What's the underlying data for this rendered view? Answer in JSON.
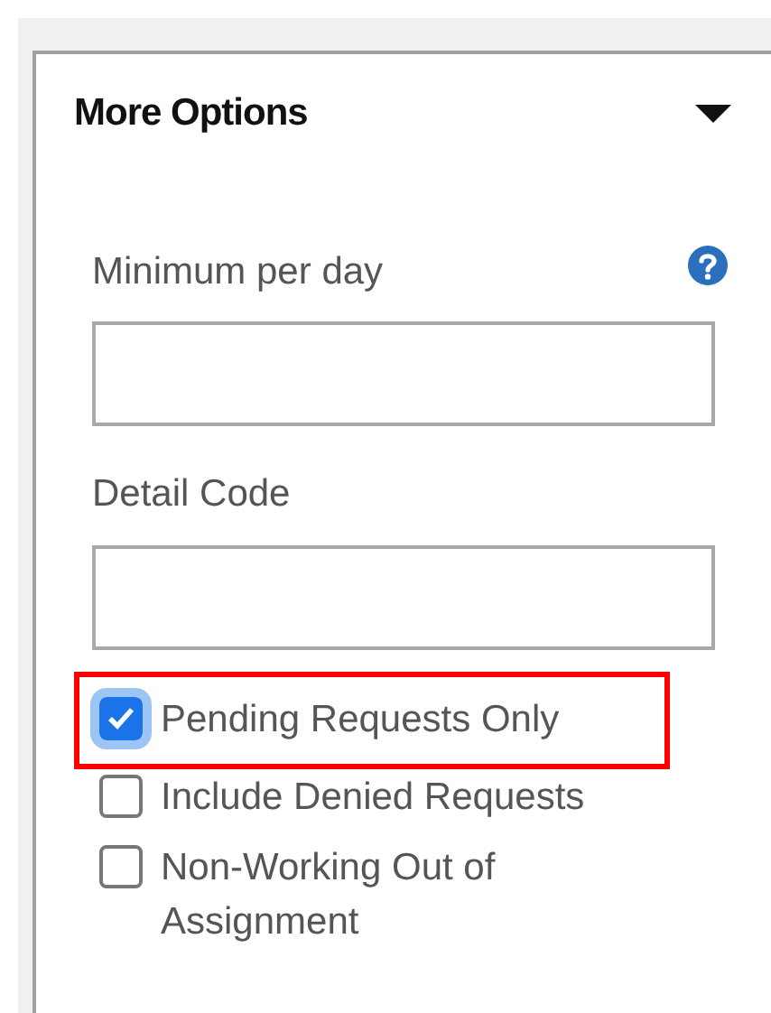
{
  "panel": {
    "title": "More Options",
    "expanded": true
  },
  "fields": [
    {
      "label": "Minimum per day",
      "help": true
    },
    {
      "label": "Detail Code",
      "help": false
    }
  ],
  "options": [
    {
      "label": "Pending Requests Only",
      "checked": true,
      "highlighted": true
    },
    {
      "label": "Include Denied Requests",
      "checked": false,
      "highlighted": false
    },
    {
      "label": "Non-Working Out of Assignment",
      "checked": false,
      "highlighted": false
    }
  ]
}
